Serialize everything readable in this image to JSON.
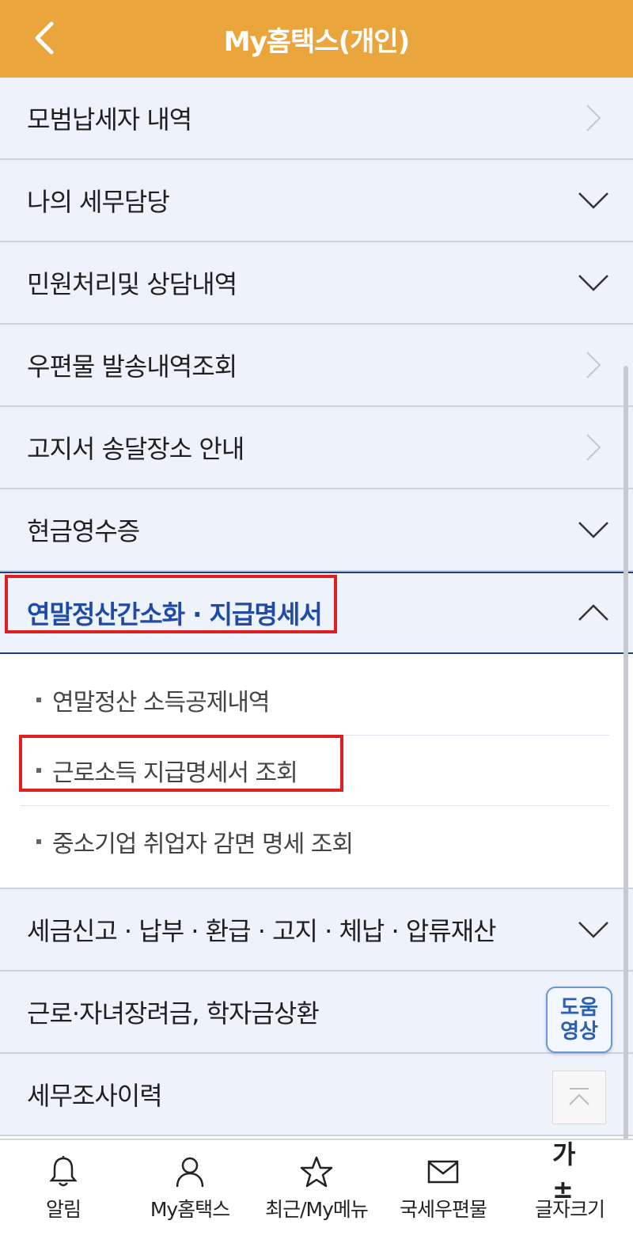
{
  "header": {
    "title": "My홈택스(개인)",
    "back_icon": "chevron-left-icon"
  },
  "menu": {
    "items": [
      {
        "label": "모범납세자 내역",
        "icon": "chevron-right-icon"
      },
      {
        "label": "나의 세무담당",
        "icon": "chevron-down-icon"
      },
      {
        "label": "민원처리및 상담내역",
        "icon": "chevron-down-icon"
      },
      {
        "label": "우편물 발송내역조회",
        "icon": "chevron-right-icon"
      },
      {
        "label": "고지서 송달장소 안내",
        "icon": "chevron-right-icon"
      },
      {
        "label": "현금영수증",
        "icon": "chevron-down-icon"
      },
      {
        "label": "연말정산간소화 · 지급명세서",
        "icon": "chevron-up-icon"
      },
      {
        "label": "세금신고 · 납부 · 환급 · 고지 · 체납 · 압류재산",
        "icon": "chevron-down-icon"
      },
      {
        "label": "근로·자녀장려금, 학자금상환",
        "icon": "chevron-down-icon"
      },
      {
        "label": "세무조사이력",
        "icon": "chevron-right-icon"
      }
    ],
    "submenu": [
      {
        "label": "연말정산 소득공제내역"
      },
      {
        "label": "근로소득 지급명세서 조회"
      },
      {
        "label": "중소기업 취업자 감면 명세 조회"
      }
    ]
  },
  "floating": {
    "help_line1": "도움",
    "help_line2": "영상",
    "top_icon": "scroll-top-icon"
  },
  "tabbar": {
    "tabs": [
      {
        "label": "알림",
        "icon": "bell-icon"
      },
      {
        "label": "My홈택스",
        "icon": "person-icon"
      },
      {
        "label": "최근/My메뉴",
        "icon": "star-icon"
      },
      {
        "label": "국세우편물",
        "icon": "mail-icon"
      },
      {
        "label": "글자크기",
        "icon_text": "가±"
      }
    ]
  },
  "colors": {
    "header_bg": "#eaa53c",
    "active_text": "#1f4aa8",
    "highlight_box": "#e02020",
    "row_bg": "#eef2fa"
  }
}
